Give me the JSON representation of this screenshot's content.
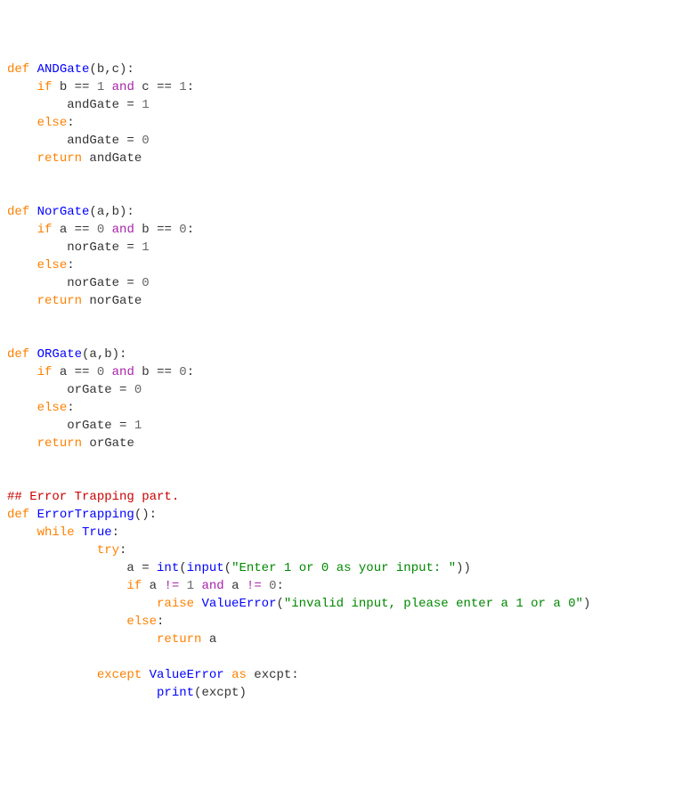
{
  "code": {
    "lines": [
      [
        [
          "kw-def",
          "def "
        ],
        [
          "fn-name",
          "ANDGate"
        ],
        [
          "txt",
          "(b,c):"
        ]
      ],
      [
        [
          "txt",
          "    "
        ],
        [
          "kw-def",
          "if"
        ],
        [
          "txt",
          " b == "
        ],
        [
          "num",
          "1"
        ],
        [
          "txt",
          " "
        ],
        [
          "kw-op",
          "and"
        ],
        [
          "txt",
          " c == "
        ],
        [
          "num",
          "1"
        ],
        [
          "txt",
          ":"
        ]
      ],
      [
        [
          "txt",
          "        andGate = "
        ],
        [
          "num",
          "1"
        ]
      ],
      [
        [
          "txt",
          "    "
        ],
        [
          "kw-def",
          "else"
        ],
        [
          "txt",
          ":"
        ]
      ],
      [
        [
          "txt",
          "        andGate = "
        ],
        [
          "num",
          "0"
        ]
      ],
      [
        [
          "txt",
          "    "
        ],
        [
          "kw-def",
          "return"
        ],
        [
          "txt",
          " andGate"
        ]
      ],
      [
        [
          "txt",
          ""
        ]
      ],
      [
        [
          "txt",
          ""
        ]
      ],
      [
        [
          "kw-def",
          "def "
        ],
        [
          "fn-name",
          "NorGate"
        ],
        [
          "txt",
          "(a,b):"
        ]
      ],
      [
        [
          "txt",
          "    "
        ],
        [
          "kw-def",
          "if"
        ],
        [
          "txt",
          " a == "
        ],
        [
          "num",
          "0"
        ],
        [
          "txt",
          " "
        ],
        [
          "kw-op",
          "and"
        ],
        [
          "txt",
          " b == "
        ],
        [
          "num",
          "0"
        ],
        [
          "txt",
          ":"
        ]
      ],
      [
        [
          "txt",
          "        norGate = "
        ],
        [
          "num",
          "1"
        ]
      ],
      [
        [
          "txt",
          "    "
        ],
        [
          "kw-def",
          "else"
        ],
        [
          "txt",
          ":"
        ]
      ],
      [
        [
          "txt",
          "        norGate = "
        ],
        [
          "num",
          "0"
        ]
      ],
      [
        [
          "txt",
          "    "
        ],
        [
          "kw-def",
          "return"
        ],
        [
          "txt",
          " norGate"
        ]
      ],
      [
        [
          "txt",
          ""
        ]
      ],
      [
        [
          "txt",
          ""
        ]
      ],
      [
        [
          "kw-def",
          "def "
        ],
        [
          "fn-name",
          "ORGate"
        ],
        [
          "txt",
          "(a,b):"
        ]
      ],
      [
        [
          "txt",
          "    "
        ],
        [
          "kw-def",
          "if"
        ],
        [
          "txt",
          " a == "
        ],
        [
          "num",
          "0"
        ],
        [
          "txt",
          " "
        ],
        [
          "kw-op",
          "and"
        ],
        [
          "txt",
          " b == "
        ],
        [
          "num",
          "0"
        ],
        [
          "txt",
          ":"
        ]
      ],
      [
        [
          "txt",
          "        orGate = "
        ],
        [
          "num",
          "0"
        ]
      ],
      [
        [
          "txt",
          "    "
        ],
        [
          "kw-def",
          "else"
        ],
        [
          "txt",
          ":"
        ]
      ],
      [
        [
          "txt",
          "        orGate = "
        ],
        [
          "num",
          "1"
        ]
      ],
      [
        [
          "txt",
          "    "
        ],
        [
          "kw-def",
          "return"
        ],
        [
          "txt",
          " orGate"
        ]
      ],
      [
        [
          "txt",
          ""
        ]
      ],
      [
        [
          "txt",
          ""
        ]
      ],
      [
        [
          "cmt",
          "## Error Trapping part."
        ]
      ],
      [
        [
          "kw-def",
          "def "
        ],
        [
          "fn-name",
          "ErrorTrapping"
        ],
        [
          "txt",
          "():"
        ]
      ],
      [
        [
          "txt",
          "    "
        ],
        [
          "kw-def",
          "while"
        ],
        [
          "txt",
          " "
        ],
        [
          "fn-name",
          "True"
        ],
        [
          "txt",
          ":"
        ]
      ],
      [
        [
          "txt",
          "            "
        ],
        [
          "kw-def",
          "try"
        ],
        [
          "txt",
          ":"
        ]
      ],
      [
        [
          "txt",
          "                a = "
        ],
        [
          "fn-name",
          "int"
        ],
        [
          "txt",
          "("
        ],
        [
          "fn-name",
          "input"
        ],
        [
          "txt",
          "("
        ],
        [
          "str",
          "\"Enter 1 or 0 as your input: \""
        ],
        [
          "txt",
          "))"
        ]
      ],
      [
        [
          "txt",
          "                "
        ],
        [
          "kw-def",
          "if"
        ],
        [
          "txt",
          " a "
        ],
        [
          "kw-op",
          "!="
        ],
        [
          "txt",
          " "
        ],
        [
          "num",
          "1"
        ],
        [
          "txt",
          " "
        ],
        [
          "kw-op",
          "and"
        ],
        [
          "txt",
          " a "
        ],
        [
          "kw-op",
          "!="
        ],
        [
          "txt",
          " "
        ],
        [
          "num",
          "0"
        ],
        [
          "txt",
          ":"
        ]
      ],
      [
        [
          "txt",
          "                    "
        ],
        [
          "kw-def",
          "raise"
        ],
        [
          "txt",
          " "
        ],
        [
          "fn-name",
          "ValueError"
        ],
        [
          "txt",
          "("
        ],
        [
          "str",
          "\"invalid input, please enter a 1 or a 0\""
        ],
        [
          "txt",
          ")"
        ]
      ],
      [
        [
          "txt",
          "                "
        ],
        [
          "kw-def",
          "else"
        ],
        [
          "txt",
          ":"
        ]
      ],
      [
        [
          "txt",
          "                    "
        ],
        [
          "kw-def",
          "return"
        ],
        [
          "txt",
          " a"
        ]
      ],
      [
        [
          "txt",
          ""
        ]
      ],
      [
        [
          "txt",
          "            "
        ],
        [
          "kw-def",
          "except"
        ],
        [
          "txt",
          " "
        ],
        [
          "fn-name",
          "ValueError"
        ],
        [
          "txt",
          " "
        ],
        [
          "kw-def",
          "as"
        ],
        [
          "txt",
          " excpt:"
        ]
      ],
      [
        [
          "txt",
          "                    "
        ],
        [
          "fn-name",
          "print"
        ],
        [
          "txt",
          "(excpt)"
        ]
      ]
    ]
  }
}
